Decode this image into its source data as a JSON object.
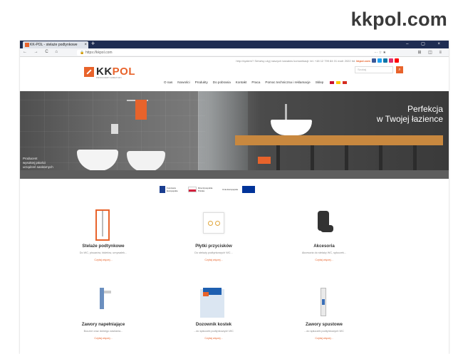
{
  "caption": {
    "domain": "kkpol.com"
  },
  "browser": {
    "tab_title": "KK-POL - stelaże podtynkowe",
    "tab_close": "×",
    "new_tab": "+",
    "window_controls": "– ▢ ×",
    "nav_buttons": "← → C ⌂",
    "url": "https://kkpol.com",
    "url_right": "··· ☆ ★",
    "nav_right": "⊞ ◫ ≡"
  },
  "site": {
    "top_info": "http://system? Serwisy użyj naszych kanałów komunikacji: tel. +48 12 799 84 01 mail: 2022 itd.",
    "top_info_highlight": "kkpol.com",
    "social_colors": [
      "#3b5998",
      "#1da1f2",
      "#0e76a8",
      "#e1306c",
      "#ff0000"
    ],
    "logo_kk": "KK",
    "logo_pol": "POL",
    "logo_sub": "PRODUCENT ARMATURY",
    "search_placeholder": "Szukaj",
    "search_icon": "search-icon",
    "menu": [
      "O nas",
      "Nowości",
      "Produkty",
      "Do pobrania",
      "Kontakt",
      "Praca",
      "Pomoc techniczna i reklamacje",
      "Sklep"
    ],
    "flag_colors": [
      "#c8102e",
      "#ffcc00",
      "#d52b1e"
    ]
  },
  "hero": {
    "tagline_line1": "Perfekcja",
    "tagline_line2": "w Twojej łazience",
    "caption_line1": "Producent",
    "caption_line2": "wysokiej jakości",
    "caption_line3": "urządzeń sanitarnych"
  },
  "eu": {
    "fund_label": "Fundusze Europejskie",
    "pl_label": "Rzeczpospolita Polska",
    "ue_label": "Unia Europejska"
  },
  "products": [
    {
      "title": "Stelaże podtynkowe",
      "desc": "Do WC, pisuarów, bidetów, umywalek...",
      "more": "Czytaj więcej..."
    },
    {
      "title": "Płytki przycisków",
      "desc": "Do stelaży podtynkowych WC...",
      "more": "Czytaj więcej..."
    },
    {
      "title": "Akcesoria",
      "desc": "Akcesoria do stelaży WC, spłuczek...",
      "more": "Czytaj więcej..."
    },
    {
      "title": "Zawory napełniające",
      "desc": "Boczne oraz dolnego zasilania...",
      "more": "Czytaj więcej..."
    },
    {
      "title": "Dozownik kostek",
      "desc": "...do spłuczek podtynkowych WC",
      "more": "Czytaj więcej..."
    },
    {
      "title": "Zawory spustowe",
      "desc": "...do spłuczek podtynkowych WC",
      "more": "Czytaj więcej..."
    }
  ],
  "colors": {
    "accent": "#e8632b",
    "dark_header": "#1f2d52"
  }
}
